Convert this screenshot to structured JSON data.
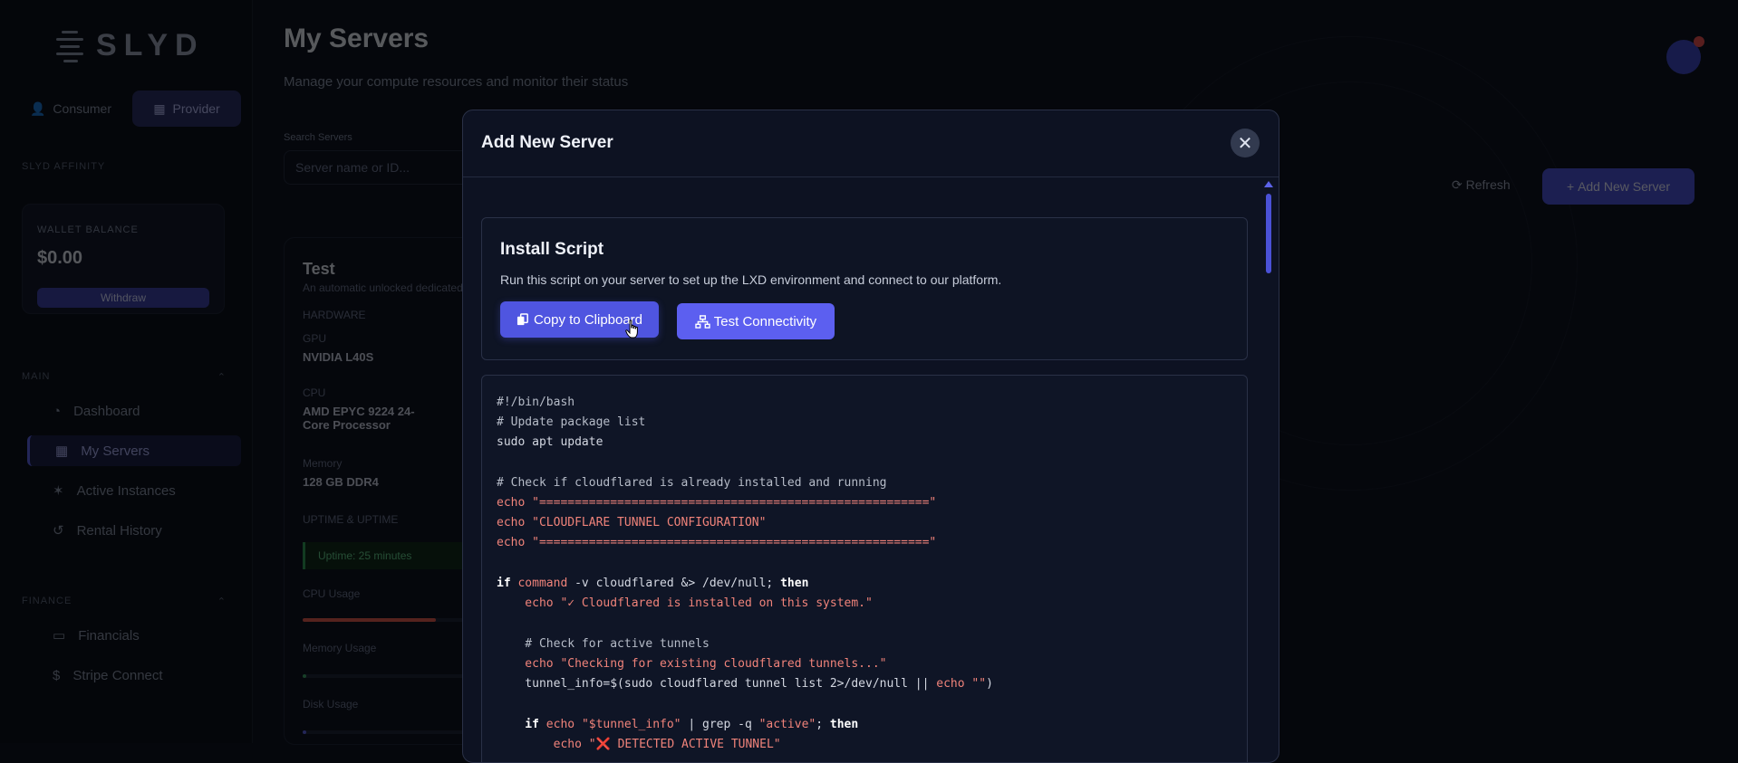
{
  "app": {
    "logo_text": "SLYD",
    "role_toggle": {
      "consumer": "Consumer",
      "provider": "Provider"
    },
    "side_heading": "SLYD AFFINITY",
    "wallet": {
      "label": "WALLET BALANCE",
      "value": "$0.00",
      "button": "Withdraw"
    },
    "nav_main_label": "MAIN",
    "nav_main": [
      "Dashboard",
      "My Servers",
      "Active Instances",
      "Rental History"
    ],
    "nav_finance_label": "FINANCE",
    "nav_finance": [
      "Financials",
      "Stripe Connect"
    ],
    "page_title": "My Servers",
    "page_subtitle": "Manage your compute resources and monitor their status",
    "search_label": "Search Servers",
    "search_placeholder": "Server name or ID...",
    "refresh_label": "Refresh",
    "add_server_label": "Add New Server",
    "server_card": {
      "name": "Test",
      "subtitle": "An automatic unlocked dedicated server",
      "hardware_label": "HARDWARE",
      "gpu_label": "GPU",
      "gpu_value": "NVIDIA L40S",
      "cpu_label": "CPU",
      "cpu_value": "AMD EPYC 9224 24-Core Processor",
      "memory_label": "Memory",
      "memory_value": "128 GB DDR4",
      "uptime_heading": "UPTIME & UPTIME",
      "uptime_badge": "Uptime: 25 minutes",
      "cpu_usage_label": "CPU Usage",
      "cpu_usage_pct": 0.7,
      "memory_usage_label": "Memory Usage",
      "memory_usage_pct": 0.02,
      "disk_usage_label": "Disk Usage",
      "disk_usage_pct": 0.02
    }
  },
  "modal": {
    "title": "Add New Server",
    "close_symbol": "✕",
    "install": {
      "title": "Install Script",
      "description": "Run this script on your server to set up the LXD environment and connect to our platform.",
      "copy_button": "Copy to Clipboard",
      "test_button": "Test Connectivity"
    },
    "code": {
      "l1": "#!/bin/bash",
      "l2": "# Update package list",
      "l3": "sudo apt update",
      "l4": "# Check if cloudflared is already installed and running",
      "l5a": "echo ",
      "l5b": "\"=======================================================\"",
      "l6a": "echo ",
      "l6b": "\"CLOUDFLARE TUNNEL CONFIGURATION\"",
      "l7a": "echo ",
      "l7b": "\"=======================================================\"",
      "l8_if": "if",
      "l8_cmd": "command",
      "l8_rest": " -v cloudflared &> /dev/null; ",
      "l8_then": "then",
      "l9a": "    echo ",
      "l9b": "\"✓ Cloudflared is installed on this system.\"",
      "l10": "    # Check for active tunnels",
      "l11a": "    echo ",
      "l11b": "\"Checking for existing cloudflared tunnels...\"",
      "l12a": "    tunnel_info=$(sudo cloudflared tunnel list 2>/dev/null || ",
      "l12b": "echo \"\"",
      "l12c": ")",
      "l13_if": "    if",
      "l13_echo": " echo ",
      "l13_str": "\"$tunnel_info\"",
      "l13_mid": " | grep -q ",
      "l13_str2": "\"active\"",
      "l13_semi": "; ",
      "l13_then": "then",
      "l14a": "        echo ",
      "l14b": "\"❌ DETECTED ACTIVE TUNNEL\""
    }
  }
}
